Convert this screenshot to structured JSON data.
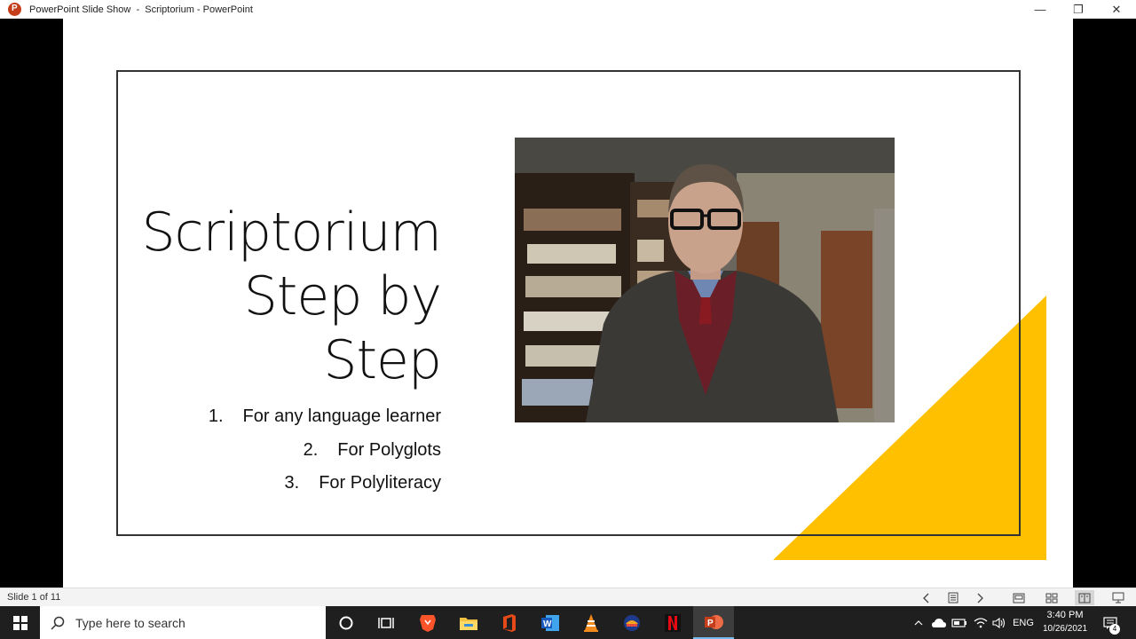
{
  "window": {
    "title": "PowerPoint Slide Show  -  Scriptorium - PowerPoint",
    "minimize": "—",
    "maximize": "❐",
    "close": "✕"
  },
  "slide": {
    "title_lines": [
      "Scriptorium",
      "Step by",
      "Step"
    ],
    "bullets": [
      {
        "num": "1.",
        "text": "For any language learner"
      },
      {
        "num": "2.",
        "text": "For Polyglots"
      },
      {
        "num": "3.",
        "text": "For Polyliteracy"
      }
    ],
    "accent_color": "#FFC000",
    "image": "webcam-presenter-photo"
  },
  "statusbar": {
    "slide_counter": "Slide 1 of 11",
    "icons": [
      "chevron-left-icon",
      "slide-menu-icon",
      "chevron-right-icon",
      "normal-view-icon",
      "slide-sorter-icon",
      "reading-view-icon",
      "slideshow-icon"
    ]
  },
  "taskbar": {
    "search_placeholder": "Type here to search",
    "apps": [
      "cortana",
      "task-view",
      "brave",
      "file-explorer",
      "office",
      "word",
      "vlc",
      "app-blue",
      "netflix",
      "powerpoint"
    ],
    "language": "ENG",
    "time": "3:40 PM",
    "date": "10/26/2021",
    "notification_count": "4"
  }
}
